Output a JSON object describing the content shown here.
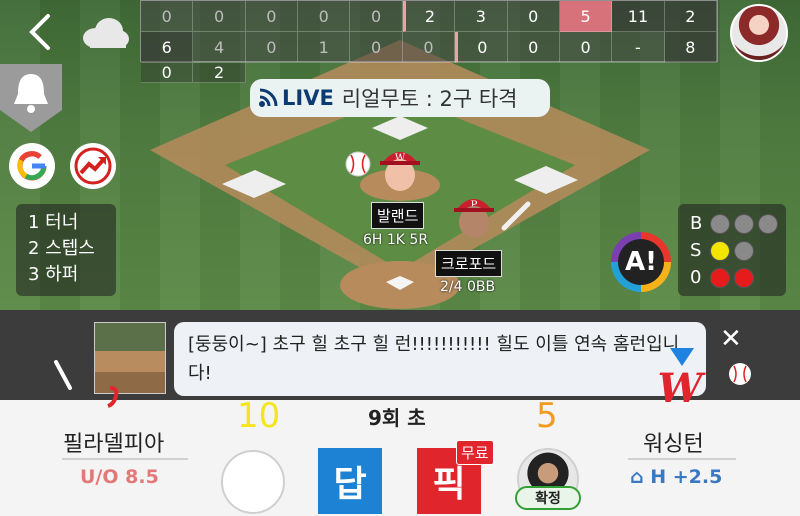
{
  "scoreboard": {
    "away_innings": [
      "0",
      "0",
      "0",
      "0",
      "0",
      "2",
      "3",
      "0",
      "5"
    ],
    "away_rhe": [
      "11",
      "2",
      "6"
    ],
    "home_innings": [
      "4",
      "0",
      "1",
      "0",
      "0",
      "0",
      "0",
      "0",
      "-"
    ],
    "home_rhe": [
      "8",
      "0",
      "2"
    ]
  },
  "live": {
    "badge": "LIVE",
    "text": "리얼무토 : 2구 타격"
  },
  "batting_order": [
    "1 터너",
    "2 스텝스",
    "3 하퍼"
  ],
  "count": {
    "ball_label": "B",
    "strike_label": "S",
    "out_value": "0",
    "balls": 0,
    "strikes": 1,
    "outs": 2
  },
  "a_logo": "A!",
  "pitcher": {
    "name": "발랜드",
    "stats": "6H 1K 5R"
  },
  "batter": {
    "name": "크로포드",
    "stats": "2/4 0BB"
  },
  "chat": {
    "message": "[둥둥이~] 초구 힐 초구 힐 런!!!!!!!!!!! 힐도 이틀 연속 홈런입니다!"
  },
  "game": {
    "away_score": "10",
    "home_score": "5",
    "inning": "9회 초",
    "away_team": "필라델피아",
    "home_team": "워싱턴",
    "uo_label": "U/O 8.5",
    "handicap_label": "H +2.5"
  },
  "buttons": {
    "answer": "답",
    "pick": "픽",
    "free": "무료",
    "confirm": "확정"
  },
  "colors": {
    "accent_blue": "#1d82d4",
    "accent_red": "#e0252d",
    "away_score": "#f5e51c",
    "home_score": "#f29b1e"
  }
}
